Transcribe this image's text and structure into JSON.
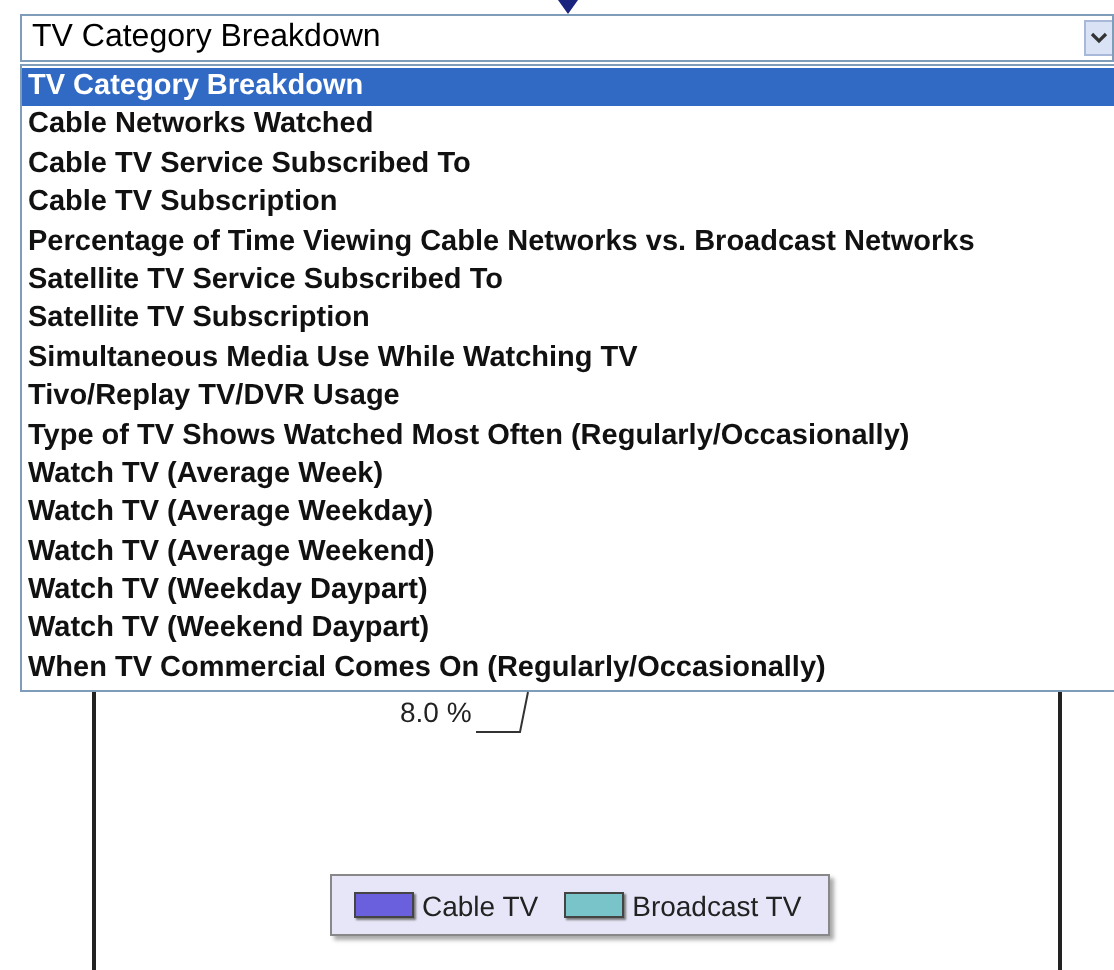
{
  "dropdown": {
    "value": "TV Category Breakdown",
    "options": [
      {
        "label": "TV Category Breakdown",
        "selected": true
      },
      {
        "label": "Cable Networks Watched",
        "selected": false
      },
      {
        "label": "Cable TV Service Subscribed To",
        "selected": false
      },
      {
        "label": "Cable TV Subscription",
        "selected": false
      },
      {
        "label": "Percentage of Time Viewing Cable Networks vs. Broadcast Networks",
        "selected": false
      },
      {
        "label": "Satellite TV Service Subscribed To",
        "selected": false
      },
      {
        "label": "Satellite TV Subscription",
        "selected": false
      },
      {
        "label": "Simultaneous Media Use While Watching TV",
        "selected": false
      },
      {
        "label": "Tivo/Replay TV/DVR Usage",
        "selected": false
      },
      {
        "label": "Type of TV Shows Watched Most Often (Regularly/Occasionally)",
        "selected": false
      },
      {
        "label": "Watch TV (Average Week)",
        "selected": false
      },
      {
        "label": "Watch TV (Average Weekday)",
        "selected": false
      },
      {
        "label": "Watch TV (Average Weekend)",
        "selected": false
      },
      {
        "label": "Watch TV (Weekday Daypart)",
        "selected": false
      },
      {
        "label": "Watch TV (Weekend Daypart)",
        "selected": false
      },
      {
        "label": "When TV Commercial Comes On (Regularly/Occasionally)",
        "selected": false
      }
    ]
  },
  "chart": {
    "data_label": "8.0 %",
    "legend": [
      {
        "label": "Cable TV",
        "color": "#6a5fdc"
      },
      {
        "label": "Broadcast TV",
        "color": "#78c4c8"
      }
    ]
  }
}
